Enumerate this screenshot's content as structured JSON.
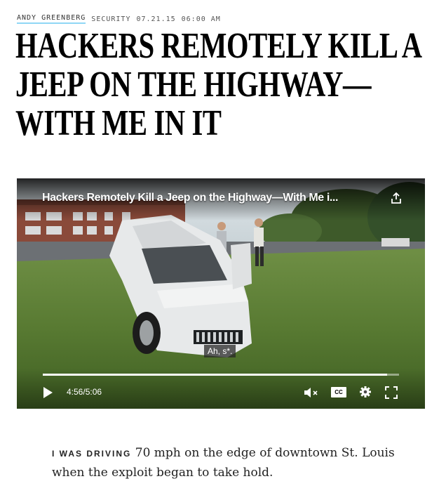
{
  "byline": {
    "author": "ANDY GREENBERG",
    "section": "SECURITY",
    "date": "07.21.15",
    "time": "06:00 AM"
  },
  "headline": "Hackers Remotely Kill a Jeep on the Highway—With Me in It",
  "video": {
    "title": "Hackers Remotely Kill a Jeep on the Highway—With Me i...",
    "caption": "Ah, s*.",
    "current_time": "4:56",
    "duration": "5:06",
    "progress": 0.967,
    "cc_label": "CC",
    "icons": [
      "share-icon",
      "play-icon",
      "mute-icon",
      "cc-icon",
      "gear-icon",
      "fullscreen-icon"
    ]
  },
  "article": {
    "lede_caps": "I was driving",
    "lede_rest": " 70 mph on the edge of downtown St. Louis when the exploit began to take hold."
  },
  "colors": {
    "author_underline": "#8fd7f5",
    "caption_bg": "#282828"
  }
}
